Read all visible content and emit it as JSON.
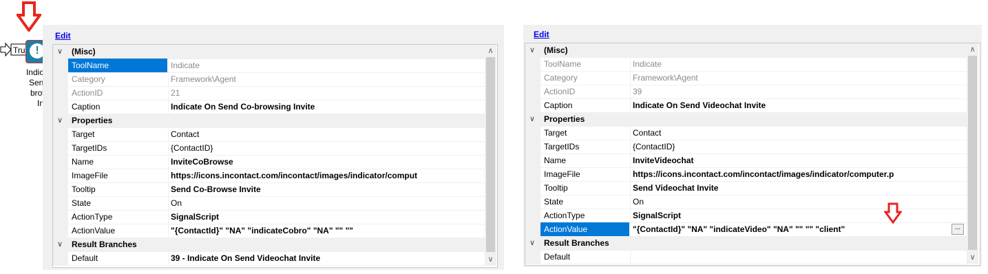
{
  "edit_label": "Edit",
  "node": {
    "true_label": "True",
    "icon_glyph": "!",
    "caption_lines": [
      "Indica",
      "Send",
      "brow",
      "Inv"
    ]
  },
  "left_panel": {
    "rows": [
      {
        "type": "category",
        "label": "(Misc)"
      },
      {
        "type": "prop",
        "label": "ToolName",
        "value": "Indicate",
        "readonly": true,
        "selected": true
      },
      {
        "type": "prop",
        "label": "Category",
        "value": "Framework\\Agent",
        "readonly": true
      },
      {
        "type": "prop",
        "label": "ActionID",
        "value": "21",
        "readonly": true
      },
      {
        "type": "prop",
        "label": "Caption",
        "value": "Indicate On Send Co-browsing Invite",
        "bold": true
      },
      {
        "type": "category",
        "label": "Properties"
      },
      {
        "type": "prop",
        "label": "Target",
        "value": "Contact"
      },
      {
        "type": "prop",
        "label": "TargetIDs",
        "value": "{ContactID}"
      },
      {
        "type": "prop",
        "label": "Name",
        "value": "InviteCoBrowse",
        "bold": true
      },
      {
        "type": "prop",
        "label": "ImageFile",
        "value": "https://icons.incontact.com/incontact/images/indicator/comput",
        "bold": true
      },
      {
        "type": "prop",
        "label": "Tooltip",
        "value": "Send Co-Browse Invite",
        "bold": true
      },
      {
        "type": "prop",
        "label": "State",
        "value": "On"
      },
      {
        "type": "prop",
        "label": "ActionType",
        "value": "SignalScript",
        "bold": true
      },
      {
        "type": "prop",
        "label": "ActionValue",
        "value": "\"{ContactId}\" \"NA\" \"indicateCobro\" \"NA\" \"\" \"\"",
        "bold": true
      },
      {
        "type": "category",
        "label": "Result Branches"
      },
      {
        "type": "prop",
        "label": "Default",
        "value": "39 - Indicate On Send Videochat Invite",
        "bold": true
      }
    ]
  },
  "right_panel": {
    "rows": [
      {
        "type": "category",
        "label": "(Misc)"
      },
      {
        "type": "prop",
        "label": "ToolName",
        "value": "Indicate",
        "readonly": true
      },
      {
        "type": "prop",
        "label": "Category",
        "value": "Framework\\Agent",
        "readonly": true
      },
      {
        "type": "prop",
        "label": "ActionID",
        "value": "39",
        "readonly": true
      },
      {
        "type": "prop",
        "label": "Caption",
        "value": "Indicate On Send Videochat Invite",
        "bold": true
      },
      {
        "type": "category",
        "label": "Properties"
      },
      {
        "type": "prop",
        "label": "Target",
        "value": "Contact"
      },
      {
        "type": "prop",
        "label": "TargetIDs",
        "value": "{ContactID}"
      },
      {
        "type": "prop",
        "label": "Name",
        "value": "InviteVideochat",
        "bold": true
      },
      {
        "type": "prop",
        "label": "ImageFile",
        "value": "https://icons.incontact.com/incontact/images/indicator/computer.p",
        "bold": true
      },
      {
        "type": "prop",
        "label": "Tooltip",
        "value": "Send Videochat Invite",
        "bold": true
      },
      {
        "type": "prop",
        "label": "State",
        "value": "On"
      },
      {
        "type": "prop",
        "label": "ActionType",
        "value": "SignalScript",
        "bold": true
      },
      {
        "type": "prop",
        "label": "ActionValue",
        "value": "\"{ContactId}\" \"NA\" \"indicateVideo\" \"NA\" \"\" \"\" \"client\"",
        "bold": true,
        "selected": true,
        "ellipsis": "..."
      },
      {
        "type": "category",
        "label": "Result Branches"
      },
      {
        "type": "prop",
        "label": "Default",
        "value": ""
      }
    ]
  },
  "colors": {
    "arrow_red": "#e8251f",
    "selection_blue": "#0078d7",
    "node_teal": "#1d7fa6"
  },
  "icons": [
    "down-arrow-icon",
    "chevron-down-icon",
    "scroll-up-icon",
    "scroll-down-icon",
    "alert-icon"
  ]
}
